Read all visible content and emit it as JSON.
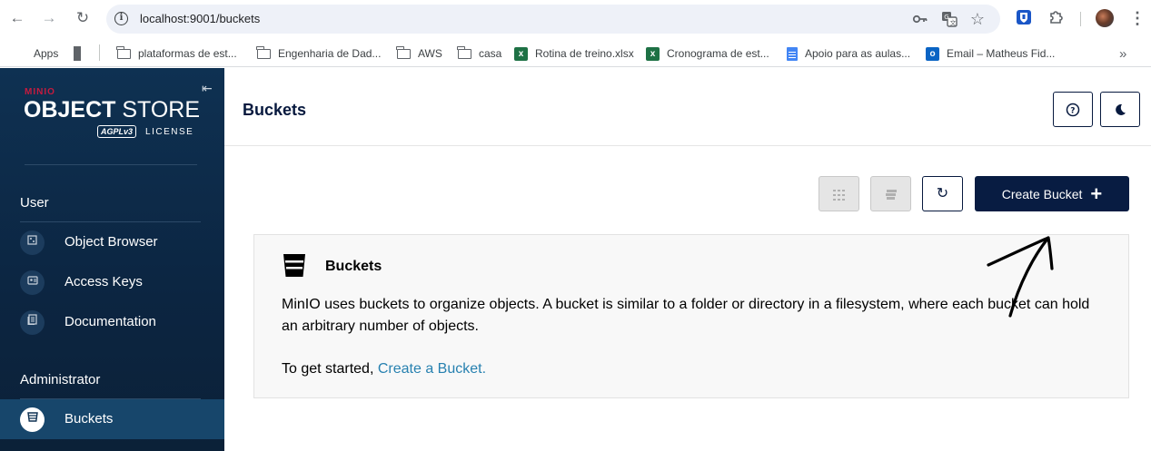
{
  "browser": {
    "url": "localhost:9001/buckets",
    "bookmarks": [
      {
        "label": "Apps",
        "icon": "apps-icon"
      },
      {
        "label": "",
        "icon": "tab-groups-icon"
      },
      {
        "label": "plataformas de est...",
        "icon": "folder-icon"
      },
      {
        "label": "Engenharia de Dad...",
        "icon": "folder-icon"
      },
      {
        "label": "AWS",
        "icon": "folder-icon"
      },
      {
        "label": "casa",
        "icon": "folder-icon"
      },
      {
        "label": "Rotina de treino.xlsx",
        "icon": "excel-icon"
      },
      {
        "label": "Cronograma de est...",
        "icon": "excel-icon"
      },
      {
        "label": "Apoio para as aulas...",
        "icon": "docs-icon"
      },
      {
        "label": "Email – Matheus Fid...",
        "icon": "outlook-icon"
      }
    ],
    "more": "»"
  },
  "sidebar": {
    "brand_top": "MINIO",
    "brand_main_1": "OBJECT",
    "brand_main_2": " STORE",
    "brand_badge": "AGPLv3",
    "brand_license": "LICENSE",
    "user_section": "User",
    "user_items": [
      "Object Browser",
      "Access Keys",
      "Documentation"
    ],
    "admin_section": "Administrator",
    "admin_items": [
      "Buckets"
    ]
  },
  "main": {
    "title": "Buckets",
    "create_button": "Create Bucket",
    "info": {
      "title": "Buckets",
      "description": "MinIO uses buckets to organize objects. A bucket is similar to a folder or directory in a filesystem, where each bucket can hold an arbitrary number of objects.",
      "start_prefix": "To get started, ",
      "start_link": "Create a Bucket."
    }
  },
  "colors": {
    "sidebar_bg": "#0e3152",
    "primary": "#081c42",
    "brand_red": "#c51b3f",
    "link": "#2781b0"
  }
}
